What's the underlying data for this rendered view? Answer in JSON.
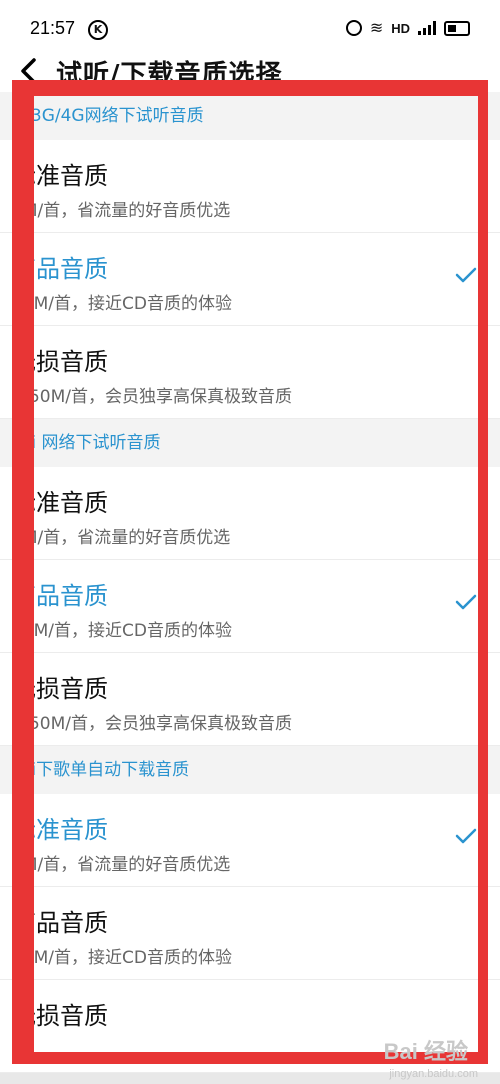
{
  "status": {
    "time": "21:57",
    "k_badge": "K",
    "network": "HD",
    "signal_label": "4G"
  },
  "header": {
    "back_icon": "chevron-left-icon",
    "title": "试听/下载音质选择"
  },
  "colors": {
    "accent": "#2a93cf",
    "highlight_border": "#e83535"
  },
  "sections": [
    {
      "title": "G/3G/4G网络下试听音质",
      "options": [
        {
          "label": "标准音质",
          "desc": "5M/首，省流量的好音质优选",
          "selected": false
        },
        {
          "label": "高品音质",
          "desc": "10M/首，接近CD音质的体验",
          "selected": true
        },
        {
          "label": "无损音质",
          "desc": "0-50M/首，会员独享高保真极致音质",
          "selected": false
        }
      ]
    },
    {
      "title": "i-Fi 网络下试听音质",
      "options": [
        {
          "label": "标准音质",
          "desc": "5M/首，省流量的好音质优选",
          "selected": false
        },
        {
          "label": "高品音质",
          "desc": "10M/首，接近CD音质的体验",
          "selected": true
        },
        {
          "label": "无损音质",
          "desc": "0-50M/首，会员独享高保真极致音质",
          "selected": false
        }
      ]
    },
    {
      "title": "i-Fi下歌单自动下载音质",
      "options": [
        {
          "label": "标准音质",
          "desc": "5M/首，省流量的好音质优选",
          "selected": true
        },
        {
          "label": "高品音质",
          "desc": "10M/首，接近CD音质的体验",
          "selected": false
        },
        {
          "label": "无损音质",
          "desc": "",
          "selected": false
        }
      ]
    }
  ],
  "watermark": {
    "brand": "Bai 经验",
    "url": "jingyan.baidu.com"
  }
}
